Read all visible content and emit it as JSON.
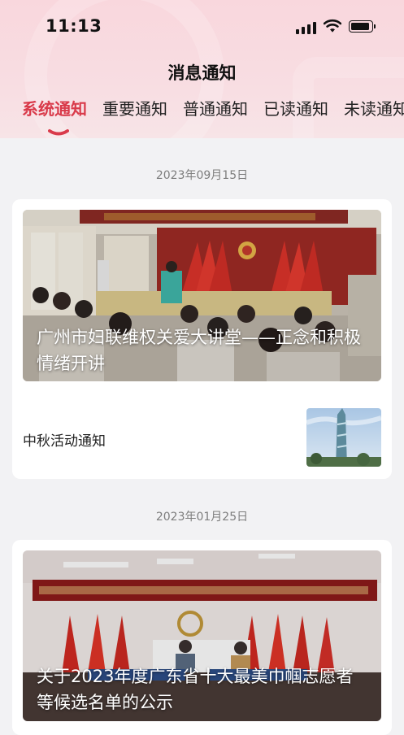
{
  "status_bar": {
    "time": "11:13"
  },
  "header": {
    "title": "消息通知",
    "tabs": [
      {
        "label": "系统通知",
        "active": true
      },
      {
        "label": "重要通知",
        "active": false
      },
      {
        "label": "普通通知",
        "active": false
      },
      {
        "label": "已读通知",
        "active": false
      },
      {
        "label": "未读通知",
        "active": false
      }
    ]
  },
  "groups": [
    {
      "date": "2023年09月15日",
      "feature": {
        "title": "广州市妇联维权关爱大讲堂——正念和积极情绪开讲"
      },
      "items": [
        {
          "title": "中秋活动通知"
        }
      ]
    },
    {
      "date": "2023年01月25日",
      "feature": {
        "title": "关于2023年度广东省十大最美巾帼志愿者等候选名单的公示"
      }
    }
  ],
  "colors": {
    "accent": "#d93a4a",
    "background": "#f2f2f4"
  }
}
